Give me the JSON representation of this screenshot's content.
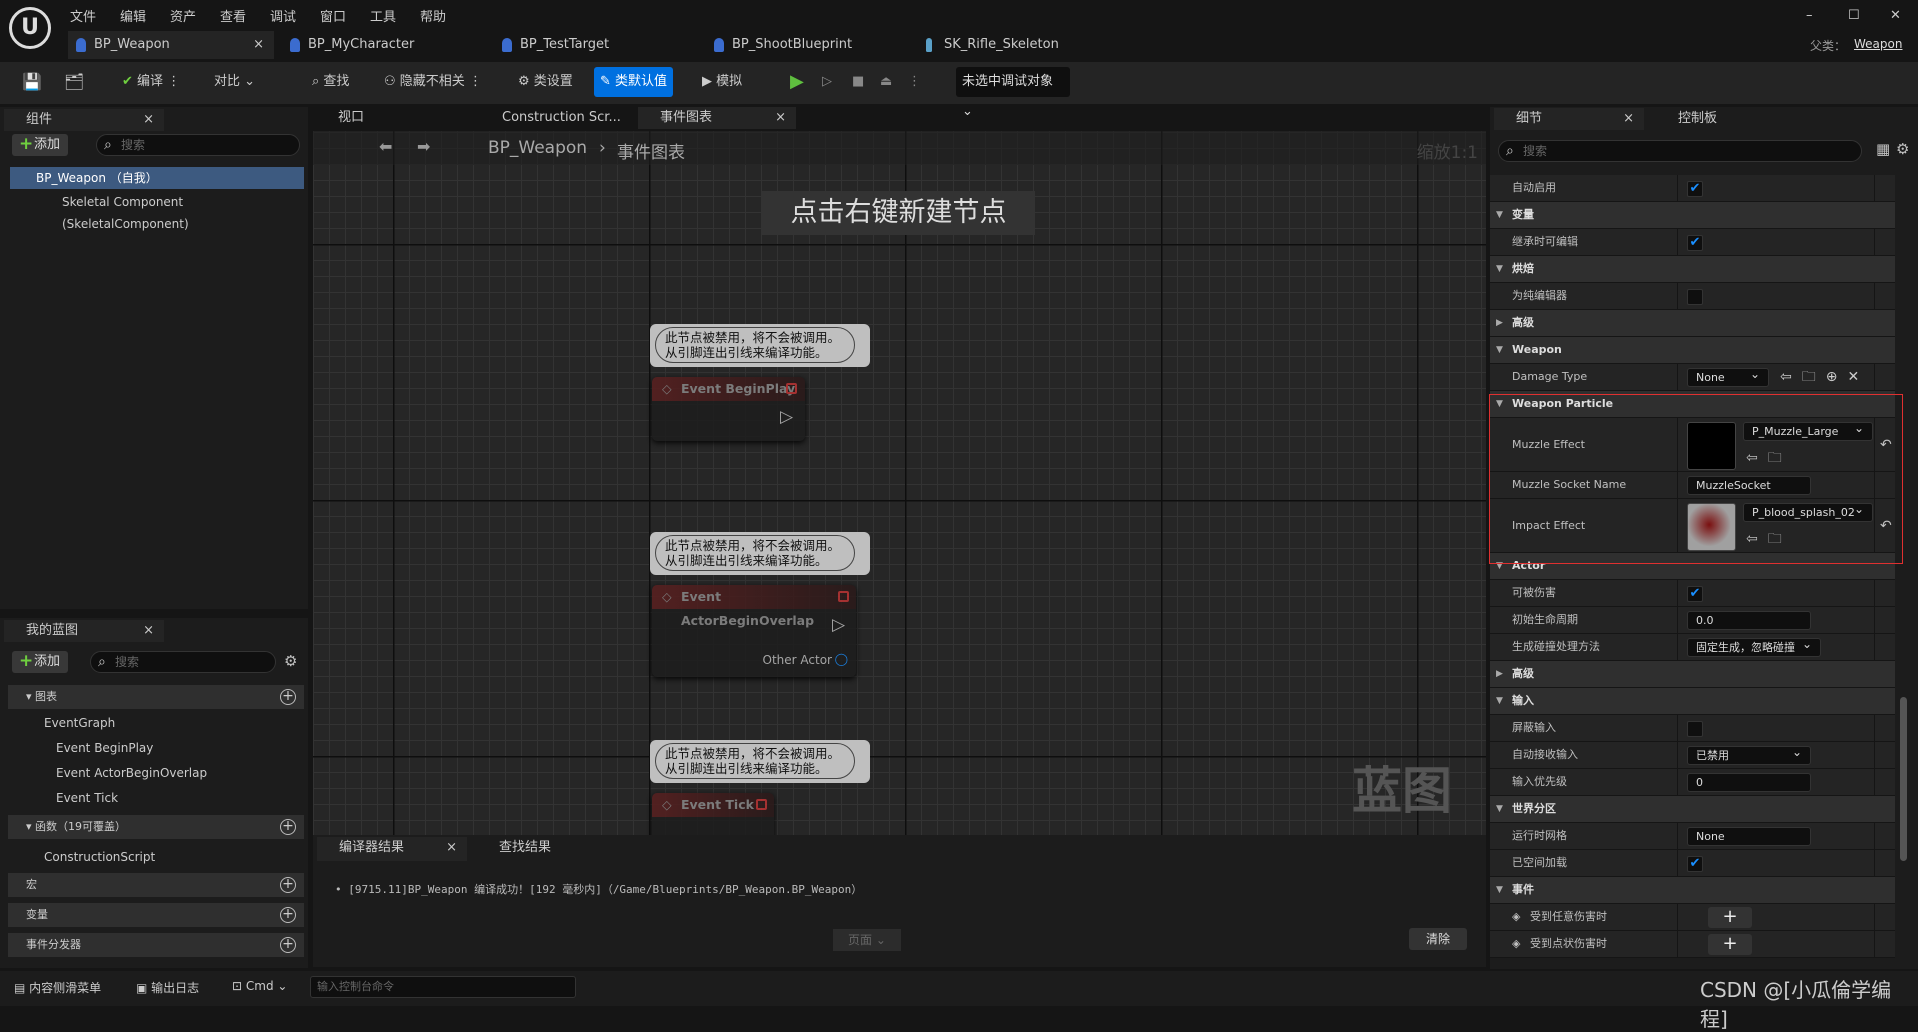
{
  "menu": [
    "文件",
    "编辑",
    "资产",
    "查看",
    "调试",
    "窗口",
    "工具",
    "帮助"
  ],
  "doc_tabs": [
    "BP_Weapon",
    "BP_MyCharacter",
    "BP_TestTarget",
    "BP_ShootBlueprint",
    "SK_Rifle_Skeleton"
  ],
  "parent_class": {
    "label": "父类：",
    "value": "Weapon"
  },
  "toolbar": {
    "compile": "编译",
    "diff": "对比",
    "find": "查找",
    "hide_unrelated": "隐藏不相关",
    "class_settings": "类设置",
    "class_defaults": "类默认值",
    "simulate": "模拟",
    "debug_target": "未选中调试对象"
  },
  "components": {
    "tab": "组件",
    "add": "添加",
    "search_placeholder": "搜索",
    "items": [
      "BP_Weapon （自我）",
      "Skeletal Component (SkeletalComponent)"
    ]
  },
  "graph_tabs": {
    "viewport": "视口",
    "construction": "Construction Scr...",
    "event_graph": "事件图表"
  },
  "graph": {
    "breadcrumb_root": "BP_Weapon",
    "breadcrumb_leaf": "事件图表",
    "zoom": "缩放1:1",
    "hint": "点击右键新建节点",
    "watermark": "蓝图",
    "comment": "此节点被禁用，将不会被调用。\n从引脚连出引线来编译功能。",
    "nodes": [
      {
        "title": "Event BeginPlay"
      },
      {
        "title": "Event ActorBeginOverlap",
        "pin": "Other Actor"
      },
      {
        "title": "Event Tick"
      }
    ]
  },
  "my_blueprint": {
    "tab": "我的蓝图",
    "add": "添加",
    "search_placeholder": "搜索",
    "graphs_label": "图表",
    "event_graph": "EventGraph",
    "events": [
      "Event BeginPlay",
      "Event ActorBeginOverlap",
      "Event Tick"
    ],
    "functions_label": "函数（19可覆盖）",
    "functions": [
      "ConstructionScript"
    ],
    "macros_label": "宏",
    "variables_label": "变量",
    "dispatchers_label": "事件分发器"
  },
  "compiler": {
    "tab": "编译器结果",
    "find_tab": "查找结果",
    "message": "[9715.11]BP_Weapon 编译成功！[192 毫秒内]（/Game/Blueprints/BP_Weapon.BP_Weapon）",
    "page": "页面",
    "clear": "清除"
  },
  "details": {
    "tab": "细节",
    "tab2": "控制板",
    "search_placeholder": "搜索",
    "rows": [
      {
        "type": "check",
        "label": "自动启用",
        "checked": true
      },
      {
        "type": "cat",
        "label": "变量",
        "expanded": true
      },
      {
        "type": "check",
        "label": "继承时可编辑",
        "checked": true
      },
      {
        "type": "cat",
        "label": "烘焙",
        "expanded": true
      },
      {
        "type": "check",
        "label": "为纯编辑器",
        "checked": false
      },
      {
        "type": "cat",
        "label": "高级",
        "expanded": false
      },
      {
        "type": "cat",
        "label": "Weapon",
        "expanded": true
      },
      {
        "type": "dropdown",
        "label": "Damage Type",
        "value": "None",
        "extras": true
      },
      {
        "type": "cat",
        "label": "Weapon Particle",
        "expanded": true,
        "highlight": true
      },
      {
        "type": "asset",
        "label": "Muzzle Effect",
        "value": "P_Muzzle_Large",
        "thumb": "#000000"
      },
      {
        "type": "text",
        "label": "Muzzle Socket Name",
        "value": "MuzzleSocket"
      },
      {
        "type": "asset",
        "label": "Impact Effect",
        "value": "P_blood_splash_02",
        "thumb": "#9a9a9a"
      },
      {
        "type": "cat",
        "label": "Actor",
        "expanded": true
      },
      {
        "type": "check",
        "label": "可被伤害",
        "checked": true
      },
      {
        "type": "text",
        "label": "初始生命周期",
        "value": "0.0"
      },
      {
        "type": "dropdown",
        "label": "生成碰撞处理方法",
        "value": "固定生成，忽略碰撞",
        "wide": true
      },
      {
        "type": "cat",
        "label": "高级",
        "expanded": false
      },
      {
        "type": "cat",
        "label": "输入",
        "expanded": true
      },
      {
        "type": "check",
        "label": "屏蔽输入",
        "checked": false
      },
      {
        "type": "dropdown",
        "label": "自动接收输入",
        "value": "已禁用"
      },
      {
        "type": "text",
        "label": "输入优先级",
        "value": "0"
      },
      {
        "type": "cat",
        "label": "世界分区",
        "expanded": true
      },
      {
        "type": "text",
        "label": "运行时网格",
        "value": "None"
      },
      {
        "type": "check",
        "label": "已空间加载",
        "checked": true
      },
      {
        "type": "cat",
        "label": "事件",
        "expanded": true
      },
      {
        "type": "event",
        "label": "受到任意伤害时"
      },
      {
        "type": "event",
        "label": "受到点状伤害时"
      }
    ]
  },
  "bottom": {
    "content_drawer": "内容侧滑菜单",
    "output_log": "输出日志",
    "cmd": "Cmd",
    "console_placeholder": "输入控制台命令"
  },
  "watermark_text": "CSDN @[小瓜倫学编程]",
  "colors": {
    "accent": "#0070e0",
    "highlight_box": "#e03030",
    "check": "#1a8fff"
  }
}
